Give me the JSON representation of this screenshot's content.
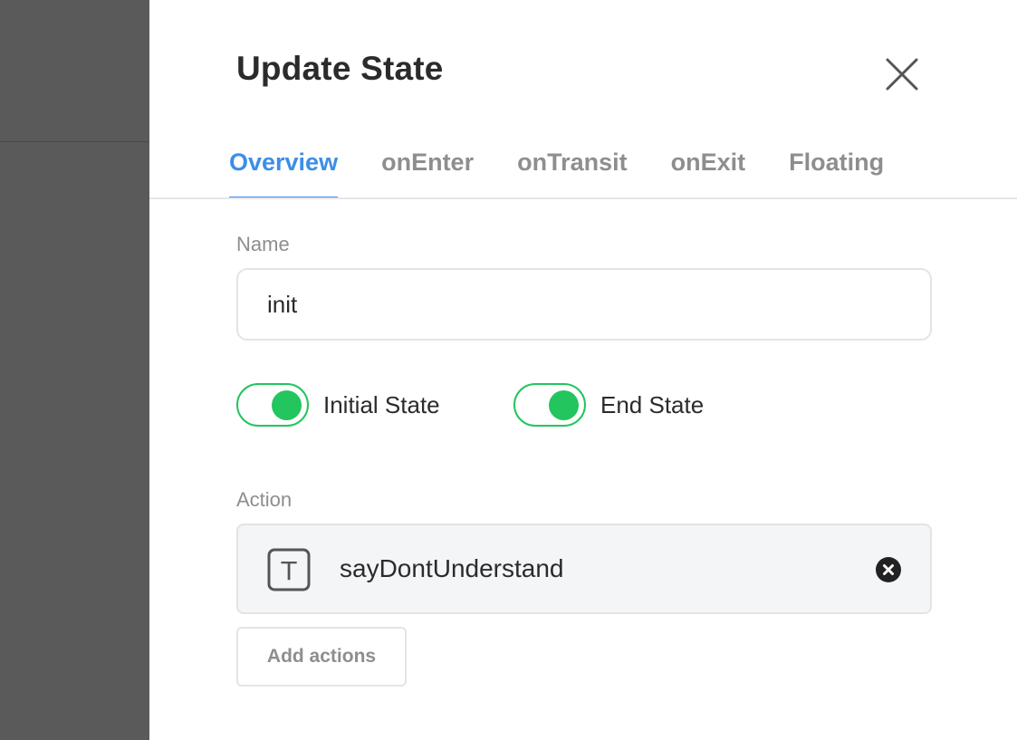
{
  "modal": {
    "title": "Update State"
  },
  "tabs": [
    {
      "label": "Overview",
      "active": true
    },
    {
      "label": "onEnter",
      "active": false
    },
    {
      "label": "onTransit",
      "active": false
    },
    {
      "label": "onExit",
      "active": false
    },
    {
      "label": "Floating",
      "active": false
    }
  ],
  "name_field": {
    "label": "Name",
    "value": "init"
  },
  "toggles": {
    "initial_state": {
      "label": "Initial State",
      "on": true
    },
    "end_state": {
      "label": "End State",
      "on": true
    }
  },
  "action": {
    "label": "Action",
    "item": {
      "type_icon": "text-icon",
      "type_icon_glyph": "T",
      "name": "sayDontUnderstand"
    },
    "add_button_label": "Add actions"
  },
  "colors": {
    "accent": "#3c8ee8",
    "toggle_on": "#22c55e",
    "backdrop": "#5a5a5a"
  }
}
